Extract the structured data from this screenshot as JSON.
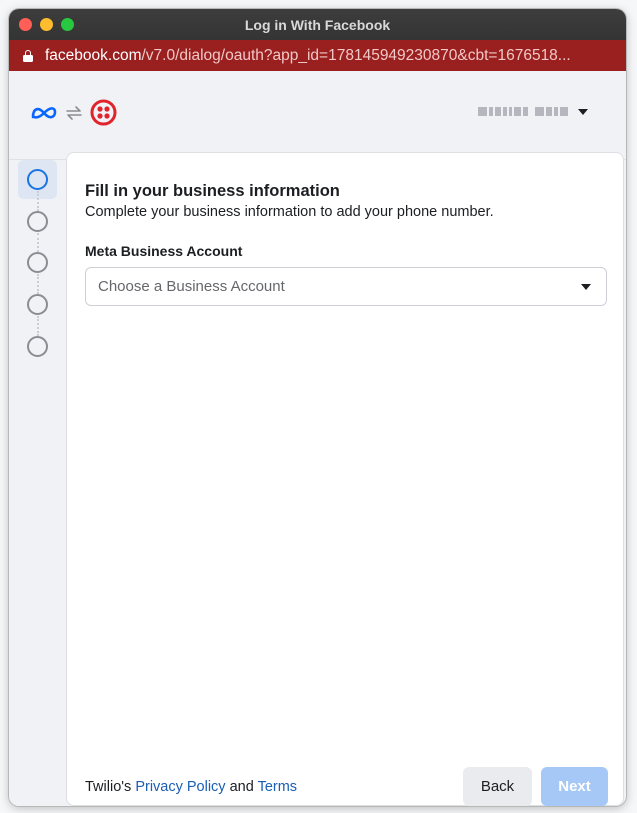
{
  "window": {
    "title": "Log in With Facebook",
    "url_domain": "facebook.com",
    "url_path": "/v7.0/dialog/oauth?app_id=178145949230870&cbt=1676518..."
  },
  "header": {
    "meta_logo": "meta-logo",
    "sync_icon": "sync-icon",
    "partner_logo": "twilio-logo",
    "account_name_redacted": true
  },
  "steps": {
    "count": 5,
    "active_index": 0
  },
  "form": {
    "title": "Fill in your business information",
    "subtitle": "Complete your business information to add your phone number.",
    "business_account_label": "Meta Business Account",
    "business_account_placeholder": "Choose a Business Account"
  },
  "footer": {
    "prefix": "Twilio's",
    "privacy_link": "Privacy Policy",
    "and": "and",
    "terms_link": "Terms",
    "back_label": "Back",
    "next_label": "Next"
  },
  "colors": {
    "url_bar": "#9a1f1f",
    "meta_blue": "#0866ff",
    "twilio_red": "#e0242b",
    "link": "#1b5fb5",
    "next_disabled": "#a6c8f7"
  }
}
